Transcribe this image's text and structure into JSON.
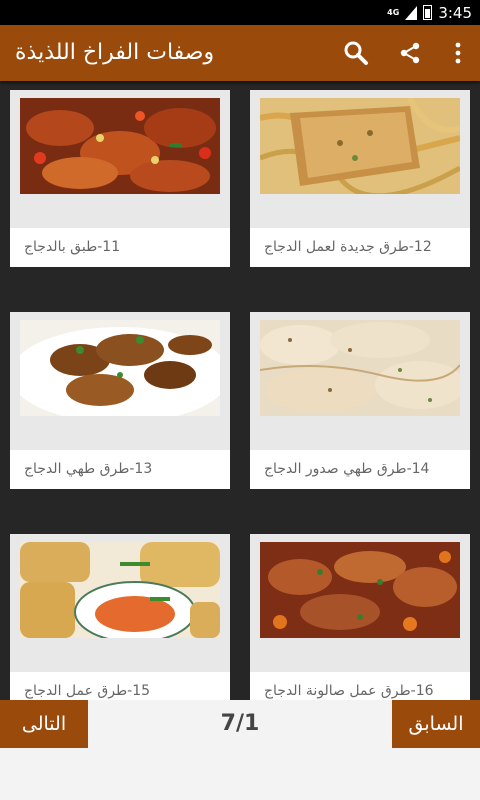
{
  "status_bar": {
    "network": "4G",
    "time": "3:45"
  },
  "app_bar": {
    "title": "وصفات الفراخ اللذيذة",
    "icons": [
      "search-icon",
      "share-icon",
      "overflow-menu-icon"
    ]
  },
  "recipes": [
    {
      "label": "11-طبق بالدجاج"
    },
    {
      "label": "12-طرق جديدة لعمل الدجاج"
    },
    {
      "label": "13-طرق طهي الدجاج"
    },
    {
      "label": "14-طرق طهي صدور الدجاج"
    },
    {
      "label": "15-طرق عمل الدجاج"
    },
    {
      "label": "16-طرق عمل صالونة الدجاج"
    }
  ],
  "pagination": {
    "next_label": "التالى",
    "page": "7/1",
    "prev_label": "السابق"
  },
  "colors": {
    "primary": "#9a4a0b",
    "grid_background": "#262626",
    "card": "#ffffff"
  }
}
